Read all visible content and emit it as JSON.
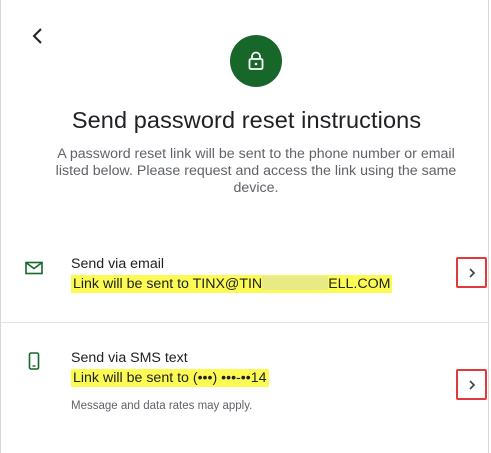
{
  "header": {
    "back_icon": "chevron-left-icon",
    "lock_icon": "lock-icon",
    "accent_color": "#17672b"
  },
  "title": "Send password reset instructions",
  "description": "A password reset link will be sent to the phone number or email listed below. Please request and access the link using the same device.",
  "options": [
    {
      "icon": "mail-icon",
      "title": "Send via email",
      "detail_prefix": "Link will be sent to TINX@TIN",
      "detail_suffix": "ELL.COM",
      "chevron": "chevron-right-icon"
    },
    {
      "icon": "phone-icon",
      "title": "Send via SMS text",
      "detail": "Link will be sent to (•••) •••-••14",
      "note": "Message and data rates may apply.",
      "chevron": "chevron-right-icon"
    }
  ],
  "highlight_color": "#fbfb54",
  "callout_color": "#e23a3a"
}
